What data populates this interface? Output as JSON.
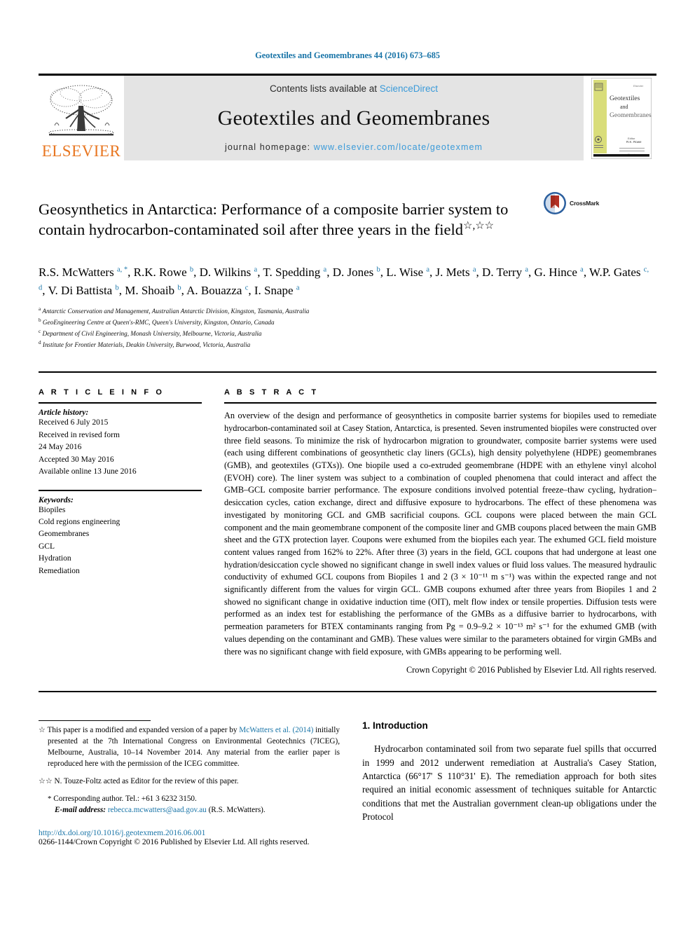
{
  "running_head": "Geotextiles and Geomembranes 44 (2016) 673–685",
  "masthead": {
    "publisher": "ELSEVIER",
    "contents_prefix": "Contents lists available at ",
    "contents_link": "ScienceDirect",
    "journal_title": "Geotextiles and Geomembranes",
    "homepage_prefix": "journal homepage: ",
    "homepage_url": "www.elsevier.com/locate/geotexmem",
    "cover": {
      "line1": "Geotextiles",
      "line2": "and",
      "line3": "Geomembranes",
      "corner": "Elsevier",
      "footer1": "Elsevier",
      "footer2": "Editor"
    }
  },
  "title": {
    "text": "Geosynthetics in Antarctica: Performance of a composite barrier system to contain hydrocarbon-contaminated soil after three years in the field",
    "daggers": "☆,☆☆"
  },
  "crossmark": {
    "label": "CrossMark"
  },
  "authors": [
    {
      "name": "R.S. McWatters",
      "sup": "a",
      "star": true
    },
    {
      "name": "R.K. Rowe",
      "sup": "b"
    },
    {
      "name": "D. Wilkins",
      "sup": "a"
    },
    {
      "name": "T. Spedding",
      "sup": "a"
    },
    {
      "name": "D. Jones",
      "sup": "b"
    },
    {
      "name": "L. Wise",
      "sup": "a"
    },
    {
      "name": "J. Mets",
      "sup": "a"
    },
    {
      "name": "D. Terry",
      "sup": "a"
    },
    {
      "name": "G. Hince",
      "sup": "a"
    },
    {
      "name": "W.P. Gates",
      "sup": "c, d"
    },
    {
      "name": "V. Di Battista",
      "sup": "b"
    },
    {
      "name": "M. Shoaib",
      "sup": "b"
    },
    {
      "name": "A. Bouazza",
      "sup": "c"
    },
    {
      "name": "I. Snape",
      "sup": "a"
    }
  ],
  "affiliations": [
    {
      "marker": "a",
      "text": "Antarctic Conservation and Management, Australian Antarctic Division, Kingston, Tasmania, Australia"
    },
    {
      "marker": "b",
      "text": "GeoEngineering Centre at Queen's-RMC, Queen's University, Kingston, Ontario, Canada"
    },
    {
      "marker": "c",
      "text": "Department of Civil Engineering, Monash University, Melbourne, Victoria, Australia"
    },
    {
      "marker": "d",
      "text": "Institute for Frontier Materials, Deakin University, Burwood, Victoria, Australia"
    }
  ],
  "article_info": {
    "heading": "A R T I C L E   I N F O",
    "history_label": "Article history:",
    "history": [
      "Received 6 July 2015",
      "Received in revised form",
      "24 May 2016",
      "Accepted 30 May 2016",
      "Available online 13 June 2016"
    ],
    "keywords_label": "Keywords:",
    "keywords": [
      "Biopiles",
      "Cold regions engineering",
      "Geomembranes",
      "GCL",
      "Hydration",
      "Remediation"
    ]
  },
  "abstract": {
    "heading": "A B S T R A C T",
    "body": "An overview of the design and performance of geosynthetics in composite barrier systems for biopiles used to remediate hydrocarbon-contaminated soil at Casey Station, Antarctica, is presented. Seven instrumented biopiles were constructed over three field seasons. To minimize the risk of hydrocarbon migration to groundwater, composite barrier systems were used (each using different combinations of geosynthetic clay liners (GCLs), high density polyethylene (HDPE) geomembranes (GMB), and geotextiles (GTXs)). One biopile used a co-extruded geomembrane (HDPE with an ethylene vinyl alcohol (EVOH) core). The liner system was subject to a combination of coupled phenomena that could interact and affect the GMB–GCL composite barrier performance. The exposure conditions involved potential freeze–thaw cycling, hydration–desiccation cycles, cation exchange, direct and diffusive exposure to hydrocarbons. The effect of these phenomena was investigated by monitoring GCL and GMB sacrificial coupons. GCL coupons were placed between the main GCL component and the main geomembrane component of the composite liner and GMB coupons placed between the main GMB sheet and the GTX protection layer. Coupons were exhumed from the biopiles each year. The exhumed GCL field moisture content values ranged from 162% to 22%. After three (3) years in the field, GCL coupons that had undergone at least one hydration/desiccation cycle showed no significant change in swell index values or fluid loss values. The measured hydraulic conductivity of exhumed GCL coupons from Biopiles 1 and 2 (3 × 10⁻¹¹ m s⁻¹) was within the expected range and not significantly different from the values for virgin GCL. GMB coupons exhumed after three years from Biopiles 1 and 2 showed no significant change in oxidative induction time (OIT), melt flow index or tensile properties. Diffusion tests were performed as an index test for establishing the performance of the GMBs as a diffusive barrier to hydrocarbons, with permeation parameters for BTEX contaminants ranging from Pg = 0.9–9.2 × 10⁻¹³ m² s⁻¹ for the exhumed GMB (with values depending on the contaminant and GMB). These values were similar to the parameters obtained for virgin GMBs and there was no significant change with field exposure, with GMBs appearing to be performing well.",
    "copyright": "Crown Copyright © 2016 Published by Elsevier Ltd. All rights reserved."
  },
  "footnotes": {
    "star_marker": "☆",
    "star_part1": "This paper is a modified and expanded version of a paper by ",
    "star_link": "McWatters et al. (2014)",
    "star_part2": " initially presented at the 7th International Congress on Environmental Geotechnics (7ICEG), Melbourne, Australia, 10–14 November 2014. Any material from the earlier paper is reproduced here with the permission of the ICEG committee.",
    "dstar_marker": "☆☆",
    "dstar_text": "N. Touze-Foltz acted as Editor for the review of this paper.",
    "corr_marker": "*",
    "corr_text": "Corresponding author. Tel.: +61 3 6232 3150.",
    "email_label": "E-mail address:",
    "email": "rebecca.mcwatters@aad.gov.au",
    "email_suffix": " (R.S. McWatters).",
    "doi": "http://dx.doi.org/10.1016/j.geotexmem.2016.06.001",
    "issn": "0266-1144/Crown Copyright © 2016 Published by Elsevier Ltd. All rights reserved."
  },
  "introduction": {
    "heading": "1. Introduction",
    "paragraph": "Hydrocarbon contaminated soil from two separate fuel spills that occurred in 1999 and 2012 underwent remediation at Australia's Casey Station, Antarctica (66°17' S 110°31' E). The remediation approach for both sites required an initial economic assessment of techniques suitable for Antarctic conditions that met the Australian government clean-up obligations under the Protocol"
  },
  "colors": {
    "link_blue": "#1a75a8",
    "sciencedirect_blue": "#3a9ad9",
    "elsevier_orange": "#e87722",
    "banner_gray": "#e4e4e4"
  }
}
